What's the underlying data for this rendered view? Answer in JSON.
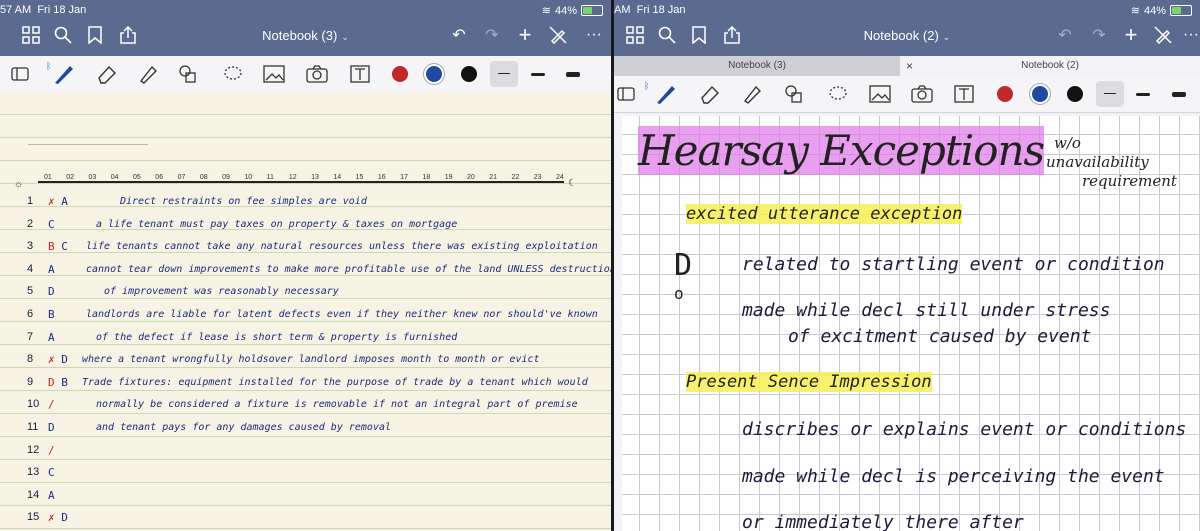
{
  "left": {
    "status_time": "57 AM",
    "status_date": "Fri 18 Jan",
    "battery": "44%",
    "battery_level": 0.44,
    "title": "Notebook (3)",
    "icons": [
      "grid-icon",
      "search-icon",
      "bookmark-icon",
      "share-icon",
      "undo-icon",
      "redo-icon",
      "add-icon",
      "no-pen-icon",
      "more-icon"
    ],
    "ruler_ticks": [
      "01",
      "02",
      "03",
      "04",
      "05",
      "06",
      "07",
      "08",
      "09",
      "10",
      "11",
      "12",
      "13",
      "14",
      "15",
      "16",
      "17",
      "18",
      "19",
      "20",
      "21",
      "22",
      "23",
      "24"
    ],
    "rows": [
      {
        "n": "1",
        "mark": "✗",
        "ans": "A",
        "text": "Direct restraints on fee simples are void"
      },
      {
        "n": "2",
        "mark": "",
        "ans": "C",
        "text": "a life tenant must pay taxes on property & taxes on mortgage"
      },
      {
        "n": "3",
        "mark": "B",
        "ans": "C",
        "text": "life tenants cannot take any natural resources unless there was existing exploitation"
      },
      {
        "n": "4",
        "mark": "",
        "ans": "A",
        "text": "cannot tear down improvements to make more profitable use of the land UNLESS destruction"
      },
      {
        "n": "5",
        "mark": "",
        "ans": "D",
        "text": "of improvement was reasonably necessary"
      },
      {
        "n": "6",
        "mark": "",
        "ans": "B",
        "text": "landlords are liable for latent defects even if they neither knew nor should've known"
      },
      {
        "n": "7",
        "mark": "",
        "ans": "A",
        "text": "of the defect if lease is short term & property is furnished"
      },
      {
        "n": "8",
        "mark": "✗",
        "ans": "D",
        "text": "where a tenant wrongfully holdsover landlord imposes month to month or evict"
      },
      {
        "n": "9",
        "mark": "D",
        "ans": "B",
        "text": "Trade fixtures: equipment installed for the purpose of trade by a tenant which would"
      },
      {
        "n": "10",
        "mark": "/",
        "ans": "",
        "text": "normally be considered a fixture is removable if not an integral part of premise"
      },
      {
        "n": "11",
        "mark": "",
        "ans": "D",
        "text": "and tenant pays for any damages caused by removal"
      },
      {
        "n": "12",
        "mark": "/",
        "ans": "",
        "text": ""
      },
      {
        "n": "13",
        "mark": "",
        "ans": "C",
        "text": ""
      },
      {
        "n": "14",
        "mark": "",
        "ans": "A",
        "text": ""
      },
      {
        "n": "15",
        "mark": "✗",
        "ans": "D",
        "text": ""
      }
    ]
  },
  "right": {
    "status_time": "AM",
    "status_date": "Fri 18 Jan",
    "battery": "44%",
    "battery_level": 0.44,
    "title": "Notebook (2)",
    "tabs": [
      "Notebook (3)",
      "Notebook (2)"
    ],
    "close_glyph": "×",
    "heading": "Hearsay Exceptions",
    "side_note": [
      "w/o",
      "unavailability",
      "requirement"
    ],
    "section1": "excited utterance exception",
    "bullets1": [
      "related to startling event or condition",
      "made while decl still under stress",
      "of excitment caused by event"
    ],
    "section2": "Present Sence Impression",
    "bullets2": [
      "discribes or explains event or conditions",
      "made while decl is perceiving the event",
      "or immediately there after"
    ]
  },
  "colors": {
    "red": "#c0292b",
    "blue": "#1f4aa0",
    "black": "#111111",
    "bar": "#5b6b8f"
  }
}
